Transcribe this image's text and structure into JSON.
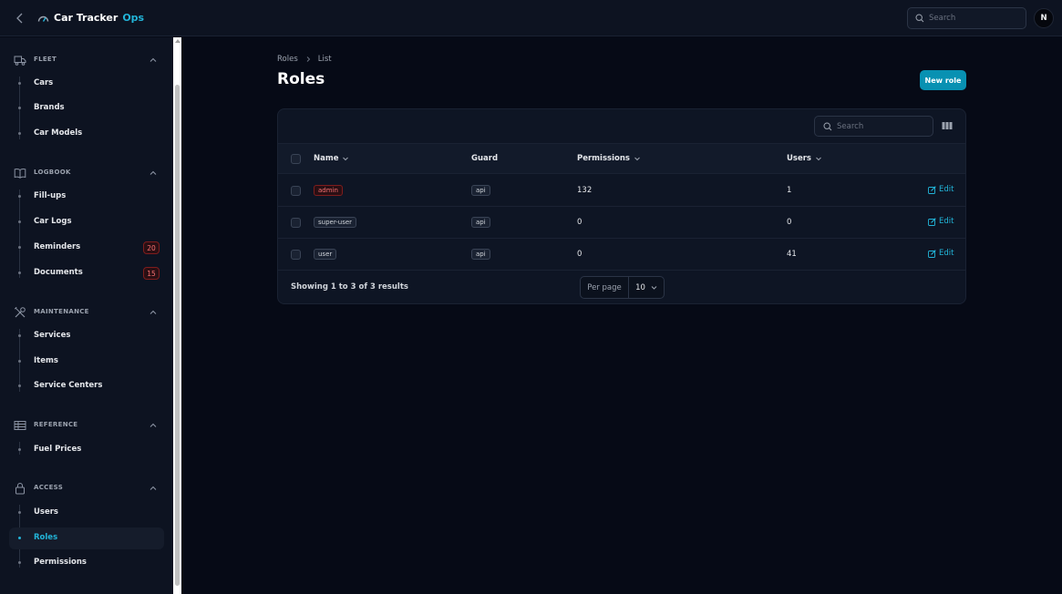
{
  "app": {
    "name": "Car Tracker",
    "name_accent": "Ops",
    "search_placeholder": "Search",
    "user_initial": "N"
  },
  "sidebar": {
    "groups": [
      {
        "label": "FLEET",
        "icon": "truck-icon",
        "items": [
          {
            "label": "Cars"
          },
          {
            "label": "Brands"
          },
          {
            "label": "Car Models"
          }
        ]
      },
      {
        "label": "LOGBOOK",
        "icon": "book-open-icon",
        "items": [
          {
            "label": "Fill-ups"
          },
          {
            "label": "Car Logs"
          },
          {
            "label": "Reminders",
            "badge": "20"
          },
          {
            "label": "Documents",
            "badge": "15"
          }
        ]
      },
      {
        "label": "MAINTENANCE",
        "icon": "tools-icon",
        "items": [
          {
            "label": "Services"
          },
          {
            "label": "Items"
          },
          {
            "label": "Service Centers"
          }
        ]
      },
      {
        "label": "REFERENCE",
        "icon": "table-icon",
        "items": [
          {
            "label": "Fuel Prices"
          }
        ]
      },
      {
        "label": "ACCESS",
        "icon": "lock-icon",
        "items": [
          {
            "label": "Users"
          },
          {
            "label": "Roles",
            "active": true
          },
          {
            "label": "Permissions"
          }
        ]
      }
    ]
  },
  "page": {
    "breadcrumb": [
      "Roles",
      "List"
    ],
    "title": "Roles",
    "new_button": "New role"
  },
  "table": {
    "search_placeholder": "Search",
    "columns": [
      "Name",
      "Guard",
      "Permissions",
      "Users"
    ],
    "rows": [
      {
        "name": "admin",
        "guard": "api",
        "permissions": "132",
        "users": "1",
        "action": "Edit"
      },
      {
        "name": "super-user",
        "guard": "api",
        "permissions": "0",
        "users": "0",
        "action": "Edit"
      },
      {
        "name": "user",
        "guard": "api",
        "permissions": "0",
        "users": "41",
        "action": "Edit"
      }
    ],
    "summary": "Showing 1 to 3 of 3 results",
    "per_page_label": "Per page",
    "per_page_value": "10"
  },
  "colors": {
    "accent": "#22b4d8",
    "primary_button": "#0891b2",
    "danger": "#f87171",
    "background": "#060a16"
  }
}
